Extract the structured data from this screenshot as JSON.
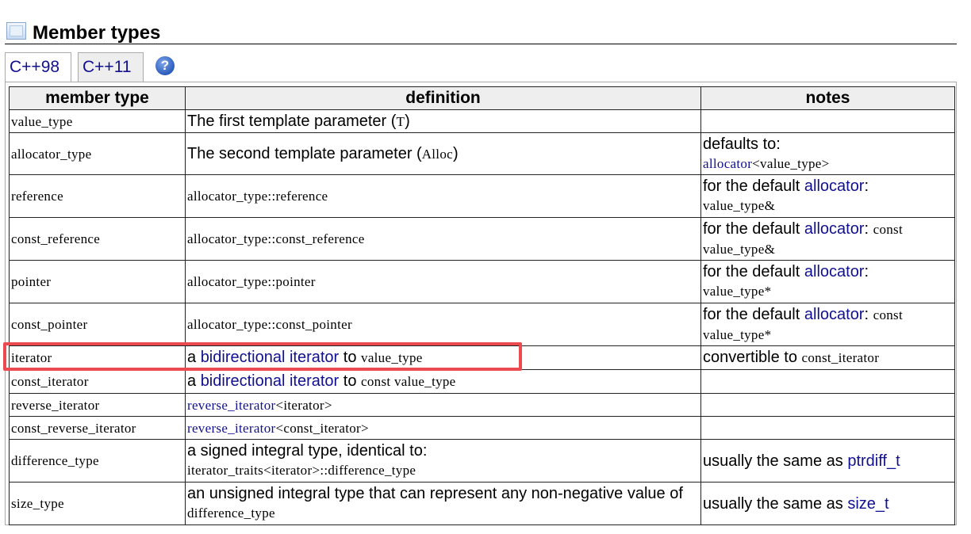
{
  "section": {
    "title": "Member types",
    "icon": "section-box-icon"
  },
  "tabs": [
    {
      "label": "C++98"
    },
    {
      "label": "C++11"
    }
  ],
  "help": {
    "label": "?"
  },
  "table": {
    "headers": {
      "member_type": "member type",
      "definition": "definition",
      "notes": "notes"
    },
    "rows": [
      {
        "name": "value_type",
        "def": {
          "t1": "The first template parameter (",
          "c1": "T",
          "t2": ")"
        },
        "notes": {}
      },
      {
        "name": "allocator_type",
        "def": {
          "t1": "The second template parameter (",
          "c1": "Alloc",
          "t2": ")"
        },
        "notes": {
          "t1": "defaults to:",
          "l1": "allocator",
          "c1": "<value_type>"
        }
      },
      {
        "name": "reference",
        "def": {
          "c1": "allocator_type::reference"
        },
        "notes": {
          "t1": "for the default ",
          "l1": "allocator",
          "t2": ":",
          "c1": "value_type&"
        }
      },
      {
        "name": "const_reference",
        "def": {
          "c1": "allocator_type::const_reference"
        },
        "notes": {
          "t1": "for the default ",
          "l1": "allocator",
          "t2": ": ",
          "c1": "const",
          "c2": "value_type&"
        }
      },
      {
        "name": "pointer",
        "def": {
          "c1": "allocator_type::pointer"
        },
        "notes": {
          "t1": "for the default ",
          "l1": "allocator",
          "t2": ":",
          "c1": "value_type*"
        }
      },
      {
        "name": "const_pointer",
        "def": {
          "c1": "allocator_type::const_pointer"
        },
        "notes": {
          "t1": "for the default ",
          "l1": "allocator",
          "t2": ": ",
          "c1": "const",
          "c2": "value_type*"
        }
      },
      {
        "name": "iterator",
        "def": {
          "t1": "a ",
          "l1": "bidirectional iterator",
          "t2": " to ",
          "c1": "value_type"
        },
        "notes": {
          "t1": "convertible to ",
          "c1": "const_iterator"
        }
      },
      {
        "name": "const_iterator",
        "def": {
          "t1": "a ",
          "l1": "bidirectional iterator",
          "t2": " to ",
          "c1": "const value_type"
        },
        "notes": {}
      },
      {
        "name": "reverse_iterator",
        "def": {
          "l1": "reverse_iterator",
          "c1": "<iterator>"
        },
        "notes": {}
      },
      {
        "name": "const_reverse_iterator",
        "def": {
          "l1": "reverse_iterator",
          "c1": "<const_iterator>"
        },
        "notes": {}
      },
      {
        "name": "difference_type",
        "def": {
          "t1": "a signed integral type, identical to:",
          "c1": "iterator_traits<iterator>::difference_type"
        },
        "notes": {
          "t1": "usually the same as ",
          "l1": "ptrdiff_t"
        }
      },
      {
        "name": "size_type",
        "def": {
          "t1": "an unsigned integral type that can represent any non-negative value of ",
          "c1": "difference_type"
        },
        "notes": {
          "t1": "usually the same as ",
          "l1": "size_t"
        }
      }
    ]
  },
  "colors": {
    "link": "#101090",
    "highlight_box": "#ea4a50",
    "header_bg": "#eeeeee"
  }
}
